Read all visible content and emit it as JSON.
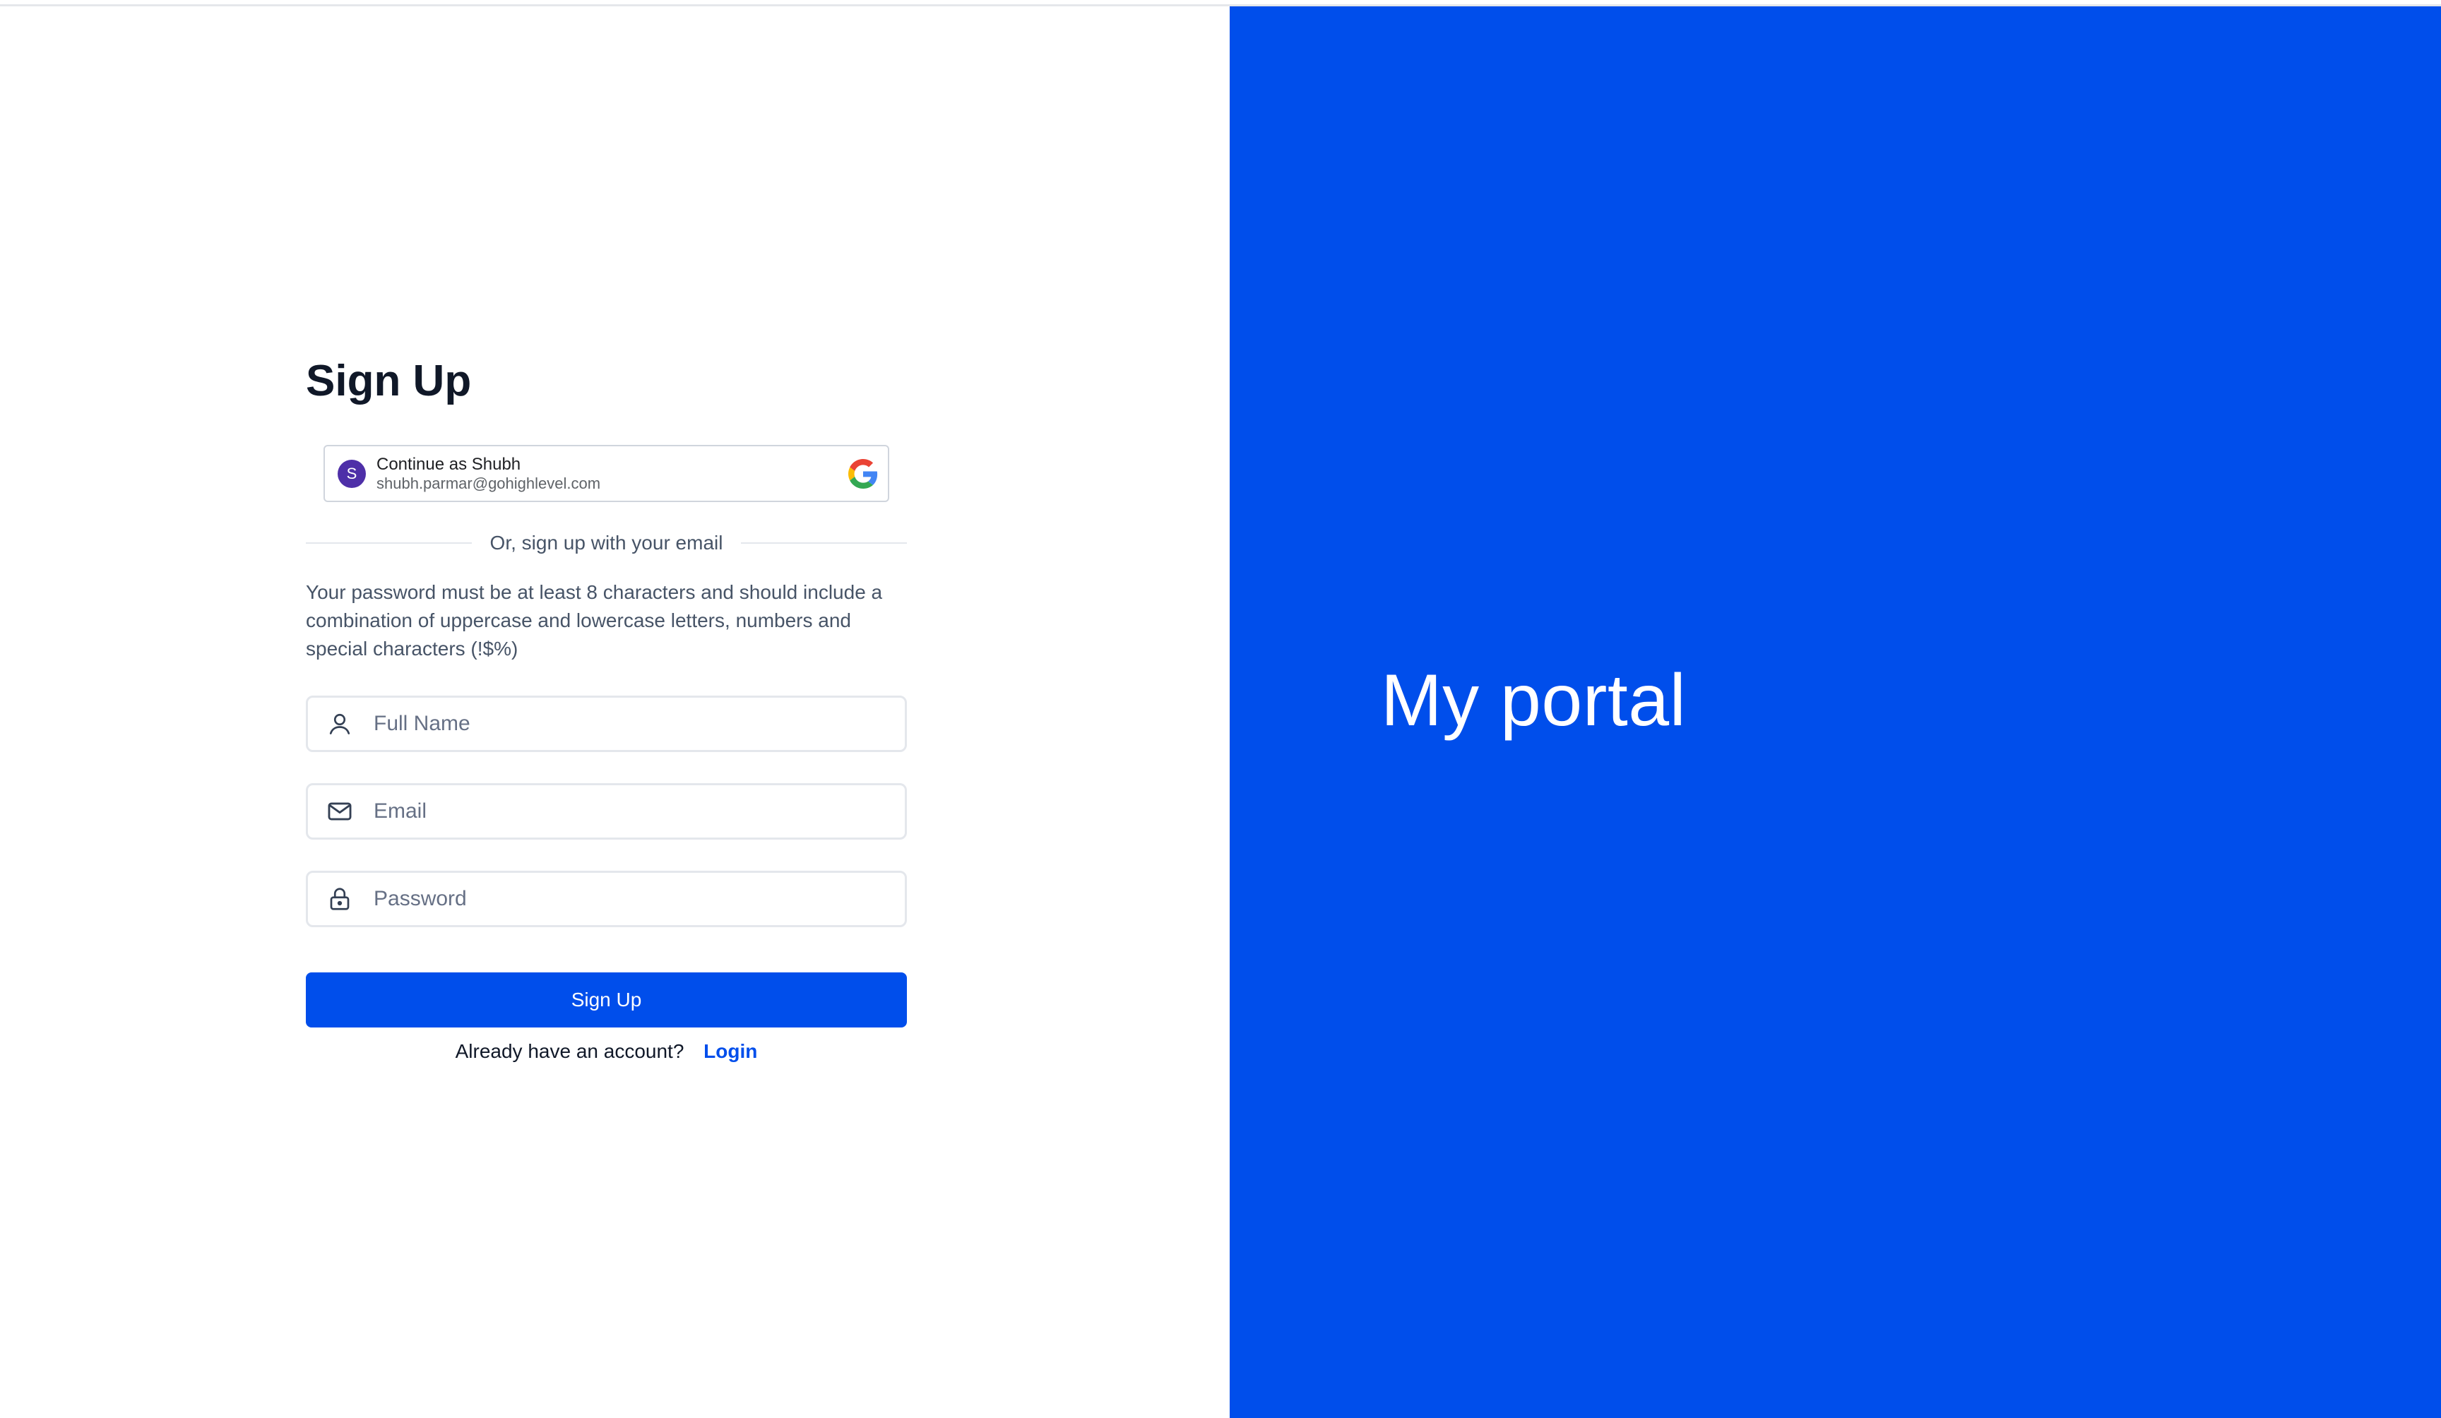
{
  "left": {
    "title": "Sign Up",
    "google": {
      "avatar_letter": "S",
      "label": "Continue as Shubh",
      "email": "shubh.parmar@gohighlevel.com"
    },
    "divider_text": "Or, sign up with your email",
    "password_note": "Your password must be at least 8 characters and should include a combination of uppercase and lowercase letters, numbers and special characters (!$%)",
    "fields": {
      "full_name": {
        "placeholder": "Full Name",
        "value": "",
        "icon": "user-icon"
      },
      "email": {
        "placeholder": "Email",
        "value": "",
        "icon": "mail-icon"
      },
      "password": {
        "placeholder": "Password",
        "value": "",
        "icon": "lock-icon"
      }
    },
    "submit_label": "Sign Up",
    "login_prompt": "Already have an account?",
    "login_link": "Login"
  },
  "right": {
    "heading": "My portal"
  },
  "colors": {
    "brand": "#004eeb",
    "avatar": "#4e2fa8"
  }
}
